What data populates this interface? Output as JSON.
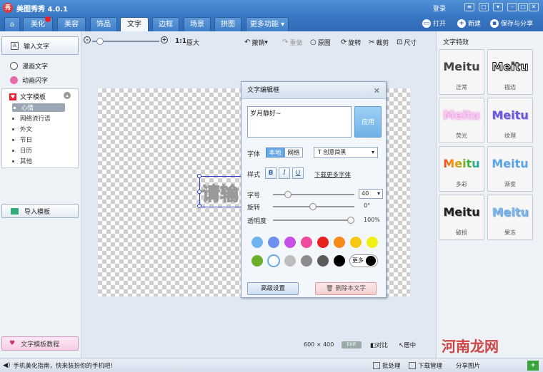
{
  "titlebar": {
    "logo": "秀",
    "title": "美图秀秀 4.0.1",
    "login": "登录"
  },
  "tabs": [
    {
      "label": "美化"
    },
    {
      "label": "美容"
    },
    {
      "label": "饰品"
    },
    {
      "label": "文字"
    },
    {
      "label": "边框"
    },
    {
      "label": "场景"
    },
    {
      "label": "拼图"
    },
    {
      "label": "更多功能 ▾"
    }
  ],
  "header_actions": {
    "open": "打开",
    "new": "新建",
    "save_share": "保存与分享"
  },
  "left": {
    "input_text": "输入文字",
    "comic_text": "漫画文字",
    "anim_text": "动画闪字",
    "template_title": "文字模板",
    "template_items": [
      "心情",
      "网络流行语",
      "外文",
      "节日",
      "日历",
      "其他"
    ],
    "import_template": "导入模板",
    "tutorial": "文字模板教程"
  },
  "toolbar": {
    "ratio": "1:1",
    "original_size": "原大",
    "undo": "撤销",
    "redo": "重做",
    "original": "原图",
    "rotate": "旋转",
    "crop": "裁剪",
    "size": "尺寸"
  },
  "canvas": {
    "text": "请输"
  },
  "dialog": {
    "title": "文字编辑框",
    "close": "✕",
    "text_value": "岁月静好~",
    "apply": "应用",
    "font_label": "字体",
    "font_local": "本地",
    "font_online": "网络",
    "font_selected": "T  创意简黑",
    "style_label": "样式",
    "bold": "B",
    "italic": "I",
    "underline": "U",
    "download_fonts": "下载更多字体",
    "size_label": "字号",
    "size_value": "40",
    "rotate_label": "旋转",
    "rotate_value": "0°",
    "opacity_label": "透明度",
    "opacity_value": "100%",
    "colors_row1": [
      "#6fb4ee",
      "#6f8ff0",
      "#c84fe6",
      "#f04a9c",
      "#e8231e",
      "#f78a18",
      "#f7c812",
      "#eef018"
    ],
    "colors_row2": [
      "#6aae2a",
      "#ffffff",
      "#bdbdbd",
      "#8c8c8c",
      "#5a5a5a",
      "#000000"
    ],
    "more": "更多",
    "advanced": "高级设置",
    "delete": "删除本文字"
  },
  "right": {
    "title": "文字特效",
    "effects": [
      {
        "sample": "Meitu",
        "label": "正常"
      },
      {
        "sample": "Meitu",
        "label": "描边"
      },
      {
        "sample": "Meitu",
        "label": "荧光"
      },
      {
        "sample": "Meitu",
        "label": "纹理"
      },
      {
        "sample": "Meitu",
        "label": "多彩"
      },
      {
        "sample": "Meitu",
        "label": "渐变"
      },
      {
        "sample": "Meitu",
        "label": "破损"
      },
      {
        "sample": "Meitu",
        "label": "果冻"
      }
    ]
  },
  "bottom": {
    "width": "600",
    "x": "×",
    "height": "400",
    "exif": "EXIF",
    "compare": "对比",
    "center": "居中"
  },
  "status": {
    "tip": "手机美化指南，快来装扮你的手机吧!",
    "batch": "批处理",
    "no_display": "下载管理",
    "share_pic": "分享图片",
    "watermark": "河南龙网"
  }
}
